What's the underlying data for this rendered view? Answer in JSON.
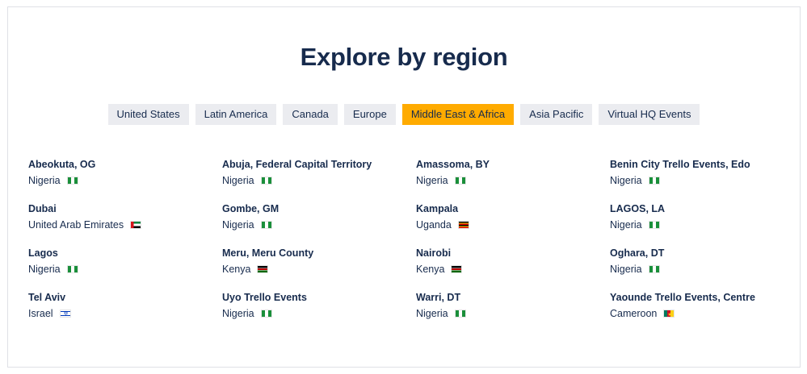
{
  "heading": "Explore by region",
  "tabs": [
    {
      "label": "United States",
      "active": false
    },
    {
      "label": "Latin America",
      "active": false
    },
    {
      "label": "Canada",
      "active": false
    },
    {
      "label": "Europe",
      "active": false
    },
    {
      "label": "Middle East & Africa",
      "active": true
    },
    {
      "label": "Asia Pacific",
      "active": false
    },
    {
      "label": "Virtual HQ Events",
      "active": false
    }
  ],
  "events": [
    {
      "name": "Abeokuta, OG",
      "country": "Nigeria",
      "flag": "nigeria-flag-icon",
      "flag_class": "ng"
    },
    {
      "name": "Abuja, Federal Capital Territory",
      "country": "Nigeria",
      "flag": "nigeria-flag-icon",
      "flag_class": "ng"
    },
    {
      "name": "Amassoma, BY",
      "country": "Nigeria",
      "flag": "nigeria-flag-icon",
      "flag_class": "ng"
    },
    {
      "name": "Benin City Trello Events, Edo",
      "country": "Nigeria",
      "flag": "nigeria-flag-icon",
      "flag_class": "ng"
    },
    {
      "name": "Dubai",
      "country": "United Arab Emirates",
      "flag": "uae-flag-icon",
      "flag_class": "ae"
    },
    {
      "name": "Gombe, GM",
      "country": "Nigeria",
      "flag": "nigeria-flag-icon",
      "flag_class": "ng"
    },
    {
      "name": "Kampala",
      "country": "Uganda",
      "flag": "uganda-flag-icon",
      "flag_class": "ug"
    },
    {
      "name": "LAGOS, LA",
      "country": "Nigeria",
      "flag": "nigeria-flag-icon",
      "flag_class": "ng"
    },
    {
      "name": "Lagos",
      "country": "Nigeria",
      "flag": "nigeria-flag-icon",
      "flag_class": "ng"
    },
    {
      "name": "Meru, Meru County",
      "country": "Kenya",
      "flag": "kenya-flag-icon",
      "flag_class": "ke"
    },
    {
      "name": "Nairobi",
      "country": "Kenya",
      "flag": "kenya-flag-icon",
      "flag_class": "ke"
    },
    {
      "name": "Oghara, DT",
      "country": "Nigeria",
      "flag": "nigeria-flag-icon",
      "flag_class": "ng"
    },
    {
      "name": "Tel Aviv",
      "country": "Israel",
      "flag": "israel-flag-icon",
      "flag_class": "il"
    },
    {
      "name": "Uyo Trello Events",
      "country": "Nigeria",
      "flag": "nigeria-flag-icon",
      "flag_class": "ng"
    },
    {
      "name": "Warri, DT",
      "country": "Nigeria",
      "flag": "nigeria-flag-icon",
      "flag_class": "ng"
    },
    {
      "name": "Yaounde Trello Events, Centre",
      "country": "Cameroon",
      "flag": "cameroon-flag-icon",
      "flag_class": "cm"
    }
  ],
  "colors": {
    "active_tab": "#ffab00",
    "tab": "#ebecf0",
    "text": "#172b4d"
  }
}
